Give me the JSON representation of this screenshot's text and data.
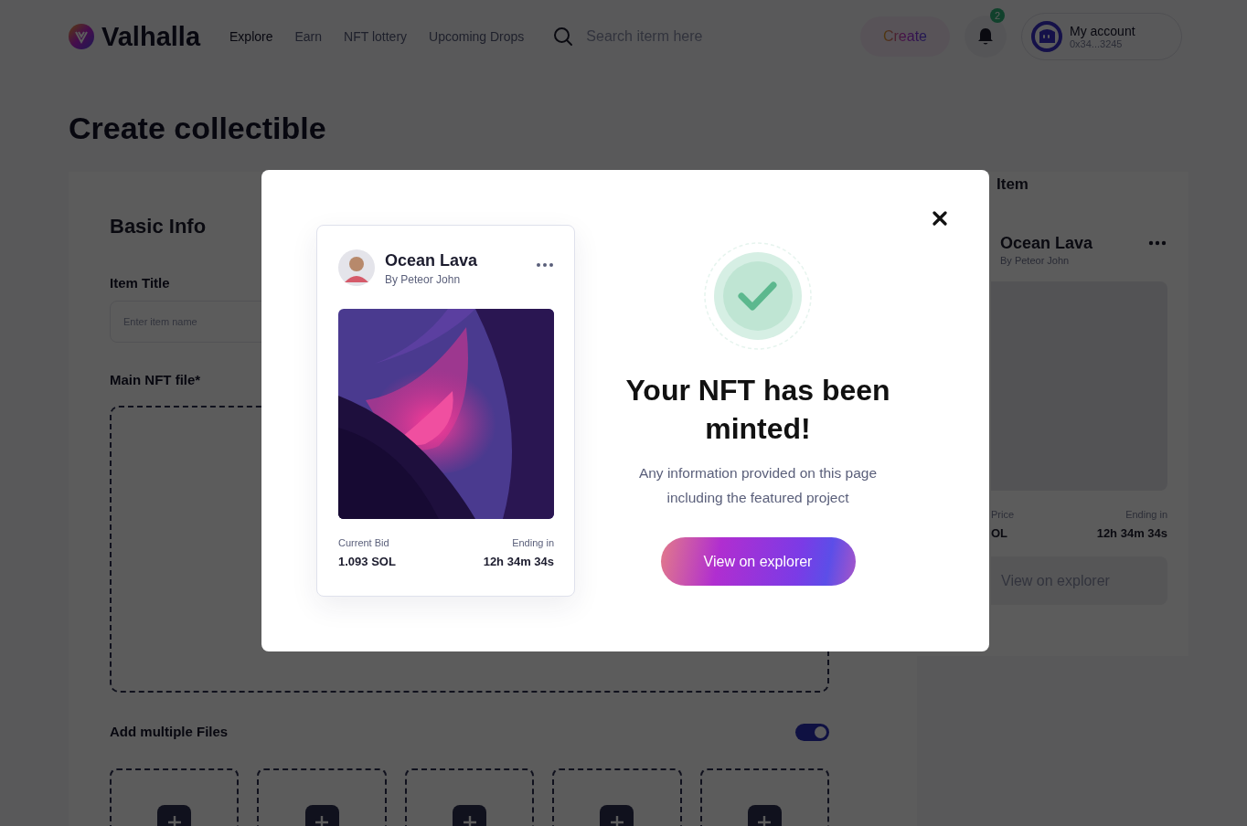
{
  "header": {
    "logo": "Valhalla",
    "nav": [
      {
        "label": "Explore",
        "selected": true
      },
      {
        "label": "Earn",
        "selected": false
      },
      {
        "label": "NFT  lottery",
        "selected": false
      },
      {
        "label": "Upcoming Drops",
        "selected": false
      }
    ],
    "search": {
      "placeholder": "Search iterm here"
    },
    "create_button": "Create",
    "notifications": {
      "count": "2"
    },
    "account": {
      "name": "My account",
      "address": "0x34...3245"
    }
  },
  "page_title": "Create collectible",
  "basic_info": {
    "heading": "Basic Info",
    "item_title": {
      "label": "Item Title",
      "placeholder": "Enter item name"
    },
    "main_file": {
      "label": "Main NFT file*"
    },
    "multiple_files": {
      "label": "Add multiple Files",
      "on": true,
      "slots": [
        {
          "kind": "empty"
        },
        {
          "kind": "empty"
        },
        {
          "kind": "empty"
        },
        {
          "kind": "empty"
        },
        {
          "kind": "empty"
        }
      ]
    }
  },
  "preview": {
    "heading": "Item",
    "title": "Ocean Lava",
    "author": "By Peteor John",
    "price_label": "Price",
    "price_value": "OL",
    "ending_label": "Ending in",
    "ending_value": "12h 34m 34s",
    "button": "View on explorer"
  },
  "modal": {
    "card": {
      "title": "Ocean Lava",
      "author": "By Peteor John",
      "bid_label": "Current Bid",
      "bid_value": "1.093 SOL",
      "ending_label": "Ending in",
      "ending_value": "12h 34m 34s"
    },
    "heading": "Your NFT has been minted!",
    "message": "Any information provided on this page including the featured project",
    "button": "View on explorer"
  }
}
